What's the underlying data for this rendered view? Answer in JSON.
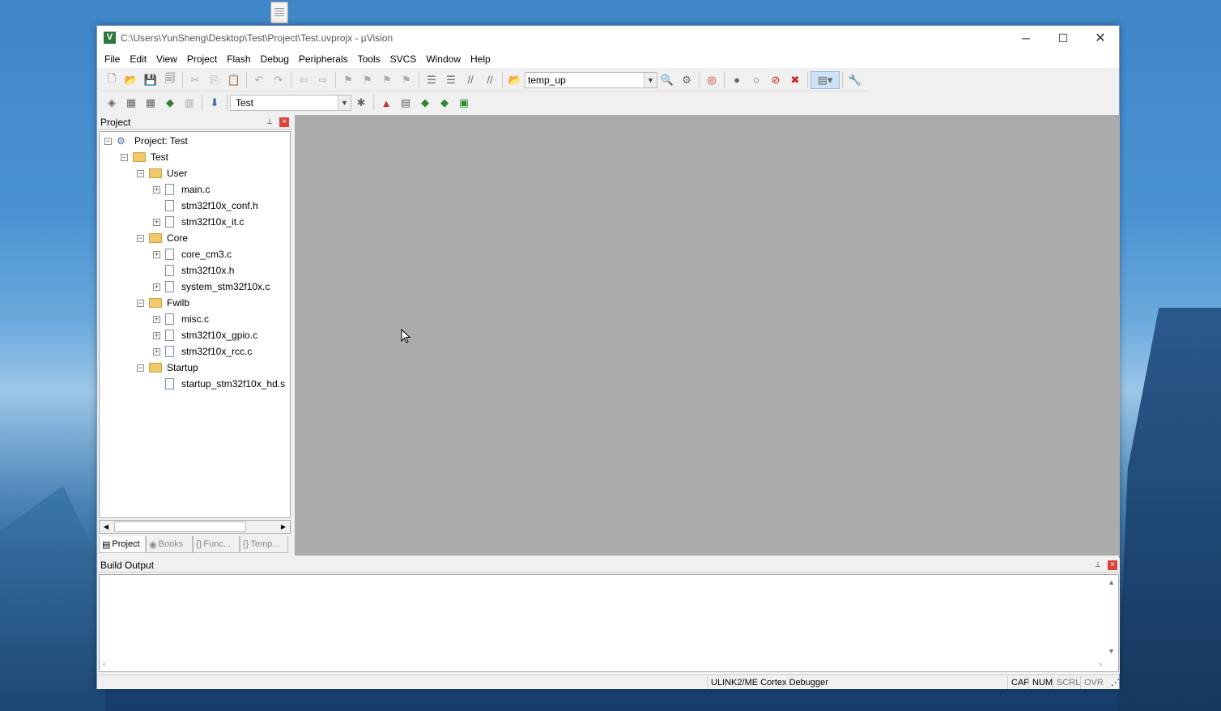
{
  "desktop": {
    "file_icon": "document-icon"
  },
  "window": {
    "title": "C:\\Users\\YunSheng\\Desktop\\Test\\Project\\Test.uvprojx - µVision",
    "controls": {
      "minimize": "─",
      "maximize": "☐",
      "close": "✕"
    }
  },
  "menu": [
    "File",
    "Edit",
    "View",
    "Project",
    "Flash",
    "Debug",
    "Peripherals",
    "Tools",
    "SVCS",
    "Window",
    "Help"
  ],
  "toolbar1": {
    "find_combo_value": "temp_up"
  },
  "toolbar2": {
    "target_combo_value": "Test"
  },
  "project_panel": {
    "title": "Project",
    "tree": [
      {
        "label": "Project: Test",
        "level": 0,
        "type": "project",
        "expander": "minus"
      },
      {
        "label": "Test",
        "level": 1,
        "type": "target",
        "expander": "minus"
      },
      {
        "label": "User",
        "level": 2,
        "type": "folder",
        "expander": "minus"
      },
      {
        "label": "main.c",
        "level": 3,
        "type": "file",
        "expander": "plus"
      },
      {
        "label": "stm32f10x_conf.h",
        "level": 3,
        "type": "file",
        "expander": "none"
      },
      {
        "label": "stm32f10x_it.c",
        "level": 3,
        "type": "file",
        "expander": "plus"
      },
      {
        "label": "Core",
        "level": 2,
        "type": "folder",
        "expander": "minus"
      },
      {
        "label": "core_cm3.c",
        "level": 3,
        "type": "file",
        "expander": "plus"
      },
      {
        "label": "stm32f10x.h",
        "level": 3,
        "type": "file",
        "expander": "none"
      },
      {
        "label": "system_stm32f10x.c",
        "level": 3,
        "type": "file",
        "expander": "plus"
      },
      {
        "label": "Fwilb",
        "level": 2,
        "type": "folder",
        "expander": "minus"
      },
      {
        "label": "misc.c",
        "level": 3,
        "type": "file",
        "expander": "plus"
      },
      {
        "label": "stm32f10x_gpio.c",
        "level": 3,
        "type": "file",
        "expander": "plus"
      },
      {
        "label": "stm32f10x_rcc.c",
        "level": 3,
        "type": "file",
        "expander": "plus"
      },
      {
        "label": "Startup",
        "level": 2,
        "type": "folder",
        "expander": "minus"
      },
      {
        "label": "startup_stm32f10x_hd.s",
        "level": 3,
        "type": "file",
        "expander": "none"
      }
    ],
    "tabs": [
      {
        "label": "Project",
        "icon": "project-tab-icon",
        "glyph": "▤",
        "active": true
      },
      {
        "label": "Books",
        "icon": "books-tab-icon",
        "glyph": "◉",
        "active": false
      },
      {
        "label": "Func...",
        "icon": "functions-tab-icon",
        "glyph": "{}",
        "active": false
      },
      {
        "label": "Temp...",
        "icon": "templates-tab-icon",
        "glyph": "{}",
        "active": false
      }
    ]
  },
  "build_output": {
    "title": "Build Output"
  },
  "statusbar": {
    "debugger": "ULINK2/ME Cortex Debugger",
    "cap": "CAP",
    "num": "NUM",
    "scrl": "SCRL",
    "ovr": "OVR"
  }
}
